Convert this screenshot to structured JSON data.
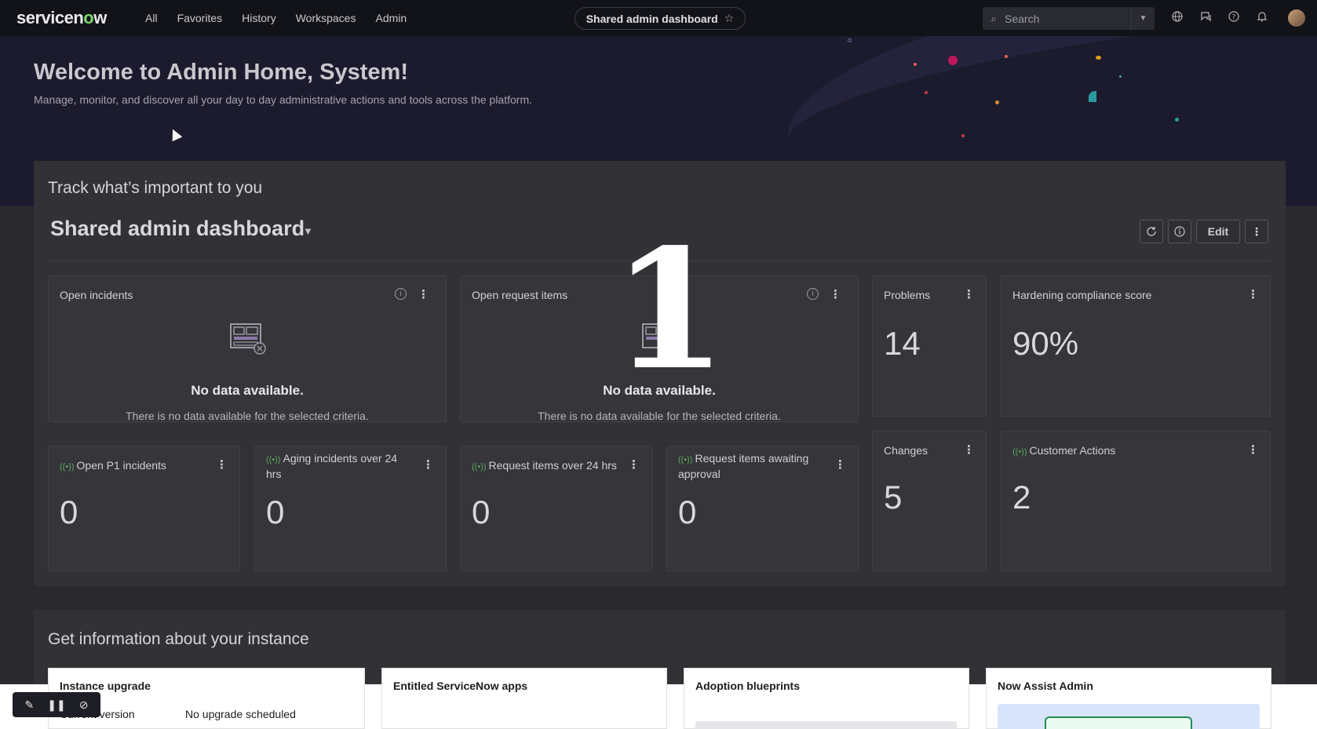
{
  "topbar": {
    "logo_prefix": "servicen",
    "logo_o": "o",
    "logo_suffix": "w",
    "nav": [
      "All",
      "Favorites",
      "History",
      "Workspaces",
      "Admin"
    ],
    "current_page": "Shared admin dashboard",
    "search_placeholder": "Search",
    "icons": [
      "globe-icon",
      "chat-icon",
      "help-icon",
      "bell-icon"
    ]
  },
  "hero": {
    "title": "Welcome to Admin Home, System!",
    "subtitle": "Manage, monitor, and discover all your day to day administrative actions and tools across the platform."
  },
  "track": {
    "title": "Track what’s important to you",
    "dashboard_title": "Shared admin dashboard",
    "edit_label": "Edit"
  },
  "cards": {
    "open_incidents": {
      "title": "Open incidents",
      "nodata_title": "No data available.",
      "nodata_text": "There is no data available for the selected criteria."
    },
    "open_requests": {
      "title": "Open request items",
      "nodata_title": "No data available.",
      "nodata_text": "There is no data available for the selected criteria."
    },
    "problems": {
      "title": "Problems",
      "value": "14"
    },
    "hardening": {
      "title": "Hardening compliance score",
      "value": "90%"
    },
    "p1": {
      "title": "Open P1 incidents",
      "value": "0"
    },
    "aging": {
      "title": "Aging incidents over 24 hrs",
      "value": "0"
    },
    "req24": {
      "title": "Request items over 24 hrs",
      "value": "0"
    },
    "req_approval": {
      "title": "Request items awaiting approval",
      "value": "0"
    },
    "changes": {
      "title": "Changes",
      "value": "5"
    },
    "customer_actions": {
      "title": "Customer Actions",
      "value": "2"
    }
  },
  "step_number": "1",
  "info": {
    "title": "Get information about your instance",
    "cards": {
      "upgrade": {
        "title": "Instance upgrade",
        "row_label": "Current version",
        "row_value": "No upgrade scheduled"
      },
      "apps": {
        "title": "Entitled ServiceNow apps"
      },
      "blueprints": {
        "title": "Adoption blueprints"
      },
      "assist": {
        "title": "Now Assist Admin"
      }
    }
  },
  "colors": {
    "accent_green": "#7dd870",
    "live_green": "#5aa85a"
  }
}
